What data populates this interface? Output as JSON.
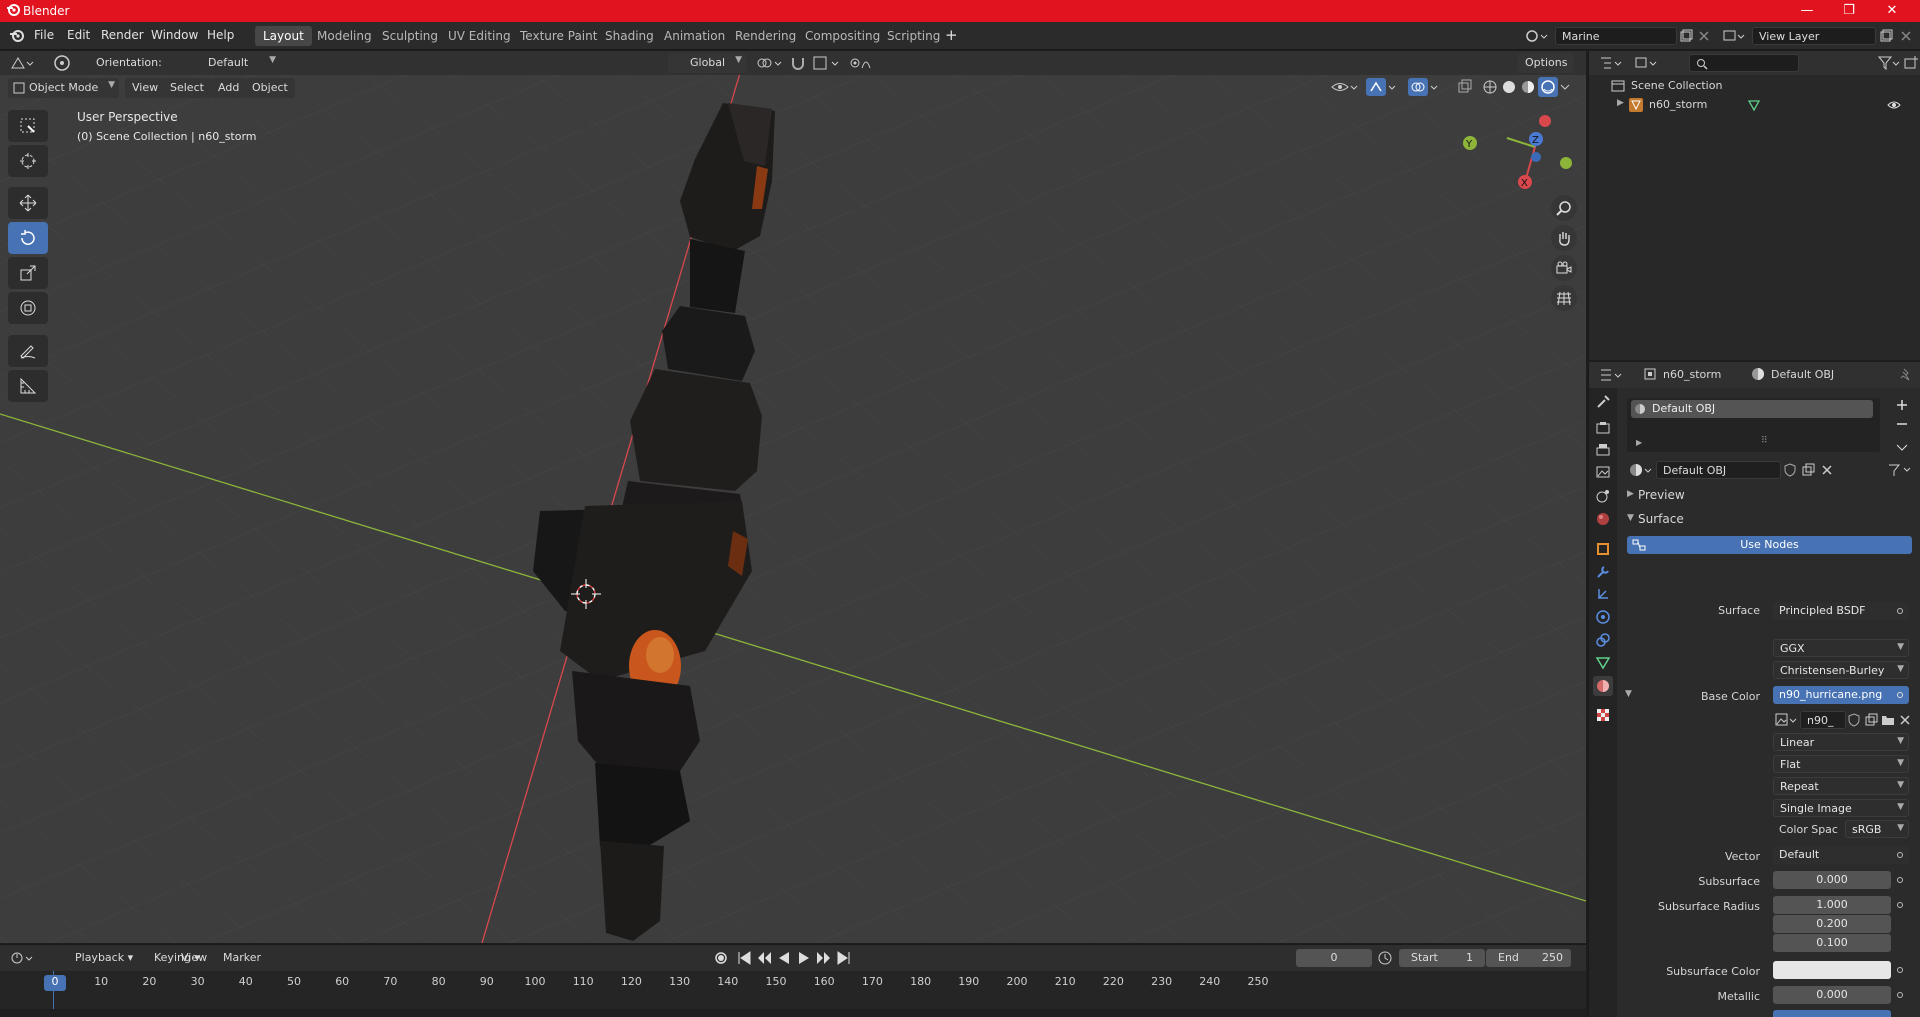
{
  "window": {
    "title": "Blender",
    "controls": {
      "minimize": "—",
      "maximize": "❐",
      "close": "✕"
    }
  },
  "menubar": {
    "menus": [
      "File",
      "Edit",
      "Render",
      "Window",
      "Help"
    ],
    "workspaces": [
      "Layout",
      "Modeling",
      "Sculpting",
      "UV Editing",
      "Texture Paint",
      "Shading",
      "Animation",
      "Rendering",
      "Compositing",
      "Scripting"
    ],
    "active_workspace": "Layout",
    "add_tab": "+",
    "scene_name": "Marine",
    "view_layer": "View Layer"
  },
  "viewport": {
    "header": {
      "orientation_label": "Orientation:",
      "orientation_value": "Default",
      "transform_orientation": "Global",
      "options_label": "Options"
    },
    "header2": {
      "mode": "Object Mode",
      "menus": [
        "View",
        "Select",
        "Add",
        "Object"
      ]
    },
    "overlay": {
      "perspective": "User Perspective",
      "collection_info": "(0) Scene Collection | n60_storm"
    },
    "gizmo_axes": {
      "x": "X",
      "y": "Y",
      "z": "Z"
    },
    "colors": {
      "background": "#3d3d3d",
      "x_axis": "#d8484c",
      "y_axis": "#8cb53a",
      "active_tool": "#4772b3"
    }
  },
  "toolbar": {
    "tools": [
      "select-box",
      "cursor",
      "move",
      "rotate",
      "scale",
      "transform",
      "annotate",
      "measure"
    ],
    "active_tool": "rotate"
  },
  "timeline": {
    "menus": [
      "Playback",
      "Keying",
      "View",
      "Marker"
    ],
    "current_frame": "0",
    "start_label": "Start",
    "start_value": "1",
    "end_label": "End",
    "end_value": "250",
    "ruler_ticks": [
      "0",
      "10",
      "20",
      "30",
      "40",
      "50",
      "60",
      "70",
      "80",
      "90",
      "100",
      "110",
      "120",
      "130",
      "140",
      "150",
      "160",
      "170",
      "180",
      "190",
      "200",
      "210",
      "220",
      "230",
      "240",
      "250"
    ]
  },
  "outliner": {
    "root": "Scene Collection",
    "items": [
      {
        "name": "n60_storm"
      }
    ]
  },
  "properties": {
    "header": {
      "object": "n60_storm",
      "material": "Default OBJ"
    },
    "material_slot": "Default OBJ",
    "material_name": "Default OBJ",
    "panels": {
      "preview": "Preview",
      "surface": "Surface"
    },
    "use_nodes": "Use Nodes",
    "fields": {
      "surface_label": "Surface",
      "surface_value": "Principled BSDF",
      "distribution": "GGX",
      "subsurface_method": "Christensen-Burley",
      "base_color_label": "Base Color",
      "base_color_value": "n90_hurricane.png",
      "image_short": "n90_",
      "interpolation": "Linear",
      "projection": "Flat",
      "extension": "Repeat",
      "source": "Single Image",
      "color_space_label": "Color Spac",
      "color_space_value": "sRGB",
      "vector_label": "Vector",
      "vector_value": "Default",
      "subsurface_label": "Subsurface",
      "subsurface_value": "0.000",
      "subsurface_radius_label": "Subsurface Radius",
      "subsurface_radius": [
        "1.000",
        "0.200",
        "0.100"
      ],
      "subsurface_color_label": "Subsurface Color",
      "metallic_label": "Metallic",
      "metallic_value": "0.000"
    }
  }
}
